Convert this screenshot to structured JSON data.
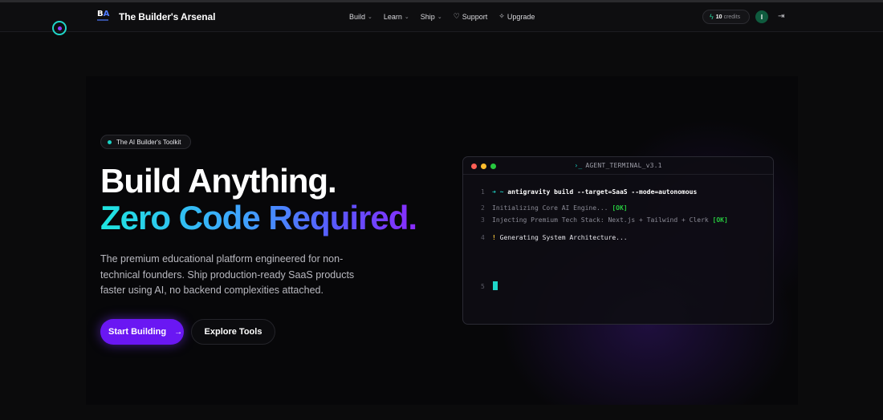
{
  "brand": {
    "logo_text_b": "B",
    "logo_text_a": "A",
    "name": "The Builder's Arsenal"
  },
  "nav": {
    "items": [
      {
        "label": "Build",
        "has_dropdown": true
      },
      {
        "label": "Learn",
        "has_dropdown": true
      },
      {
        "label": "Ship",
        "has_dropdown": true
      },
      {
        "label": "Support",
        "icon": "heart-icon"
      },
      {
        "label": "Upgrade",
        "icon": "sparkle-icon"
      }
    ]
  },
  "account": {
    "credits_count": "10",
    "credits_label": "credits",
    "avatar_initial": "I"
  },
  "hero": {
    "badge": "The AI Builder's Toolkit",
    "headline_line1": "Build Anything.",
    "headline_line2": "Zero Code Required.",
    "subtitle": "The premium educational platform engineered for non-technical founders. Ship production-ready SaaS products faster using AI, no backend complexities attached.",
    "primary_cta": "Start Building",
    "secondary_cta": "Explore Tools"
  },
  "terminal": {
    "title": "AGENT_TERMINAL_v3.1",
    "lines": [
      {
        "num": "1",
        "prefix": "➜ ~",
        "text": "antigravity build --target=SaaS --mode=autonomous"
      },
      {
        "num": "2",
        "text": "Initializing Core AI Engine...",
        "status": "[OK]"
      },
      {
        "num": "3",
        "text": "Injecting Premium Tech Stack: Next.js + Tailwind + Clerk",
        "status": "[OK]"
      },
      {
        "num": "4",
        "prefix": "!",
        "text": "Generating System Architecture..."
      },
      {
        "num": "5"
      }
    ]
  },
  "colors": {
    "accent_purple": "#6a17f3",
    "accent_cyan": "#1fd6c9",
    "ok_green": "#27c93f",
    "warn_yellow": "#f3c23c"
  }
}
